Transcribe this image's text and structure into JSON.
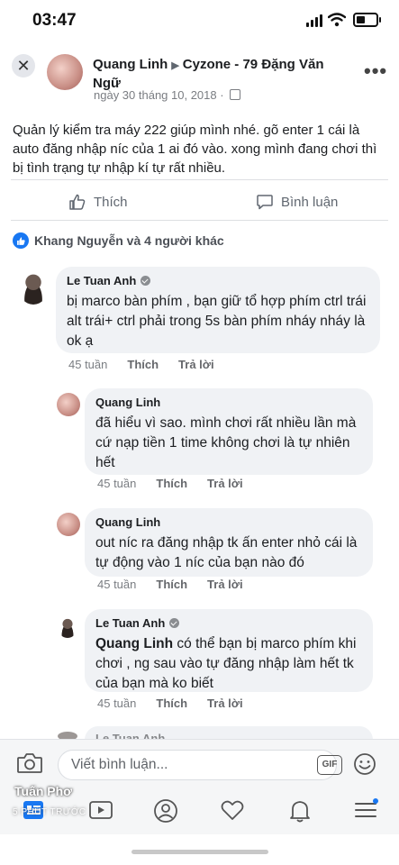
{
  "status_bar": {
    "time": "03:47"
  },
  "post": {
    "author": "Quang Linh",
    "arrow": "▶",
    "location": "Cyzone - 79 Đặng Văn Ngữ",
    "date": "ngày 30 tháng 10, 2018 ·",
    "text": "Quản lý kiểm tra máy 222 giúp mình nhé. gõ enter 1 cái là auto đăng nhập níc của 1 ai đó vào.  xong  mình đang chơi thì bị tình trạng tự nhập kí tự rất nhiều.",
    "like_label": "Thích",
    "comment_label": "Bình luận",
    "reactions_text": "Khang Nguyễn và 4 người khác"
  },
  "comments": [
    {
      "name": "Le Tuan Anh",
      "verified": true,
      "mention": "",
      "text": "bị marco bàn phím , bạn giữ tổ hợp phím ctrl trái alt trái+ ctrl phải  trong 5s bàn phím nháy nháy là ok ạ",
      "time": "45 tuần",
      "like": "Thích",
      "reply": "Trả lời"
    },
    {
      "name": "Quang Linh",
      "verified": false,
      "mention": "",
      "text": "đã hiểu vì sao. mình chơi rất nhiều lần mà cứ nạp tiền 1 time không chơi là tự nhiên hết",
      "time": "45 tuần",
      "like": "Thích",
      "reply": "Trả lời"
    },
    {
      "name": "Quang Linh",
      "verified": false,
      "mention": "",
      "text": "out níc ra đăng nhập tk ấn enter nhỏ cái là tự động vào 1 níc của bạn nào đó",
      "time": "45 tuần",
      "like": "Thích",
      "reply": "Trả lời"
    },
    {
      "name": "Le Tuan Anh",
      "verified": true,
      "mention": "Quang  Linh",
      "text": " có thể bạn bị marco phím khi chơi , ng sau vào tự đăng nhập làm hết tk của bạn mà ko biết",
      "time": "45 tuần",
      "like": "Thích",
      "reply": "Trả lời"
    },
    {
      "name": "Le Tuan Anh",
      "verified": true,
      "mention": "",
      "text": "",
      "time": "",
      "like": "",
      "reply": ""
    }
  ],
  "composer": {
    "placeholder": "Viết bình luận...",
    "gif": "GIF"
  },
  "overlay": {
    "name": "Tuấn Phơ",
    "time": "5 PHÚT TRƯỚC"
  },
  "colors": {
    "accent": "#1877f2",
    "bubble": "#f0f2f5",
    "muted": "#7a7d82"
  },
  "icons": [
    "close-icon",
    "more-icon",
    "like-icon",
    "comment-icon",
    "camera-icon",
    "emoji-icon",
    "feed-icon",
    "watch-icon",
    "profile-icon",
    "dating-icon",
    "bell-icon",
    "menu-icon"
  ]
}
